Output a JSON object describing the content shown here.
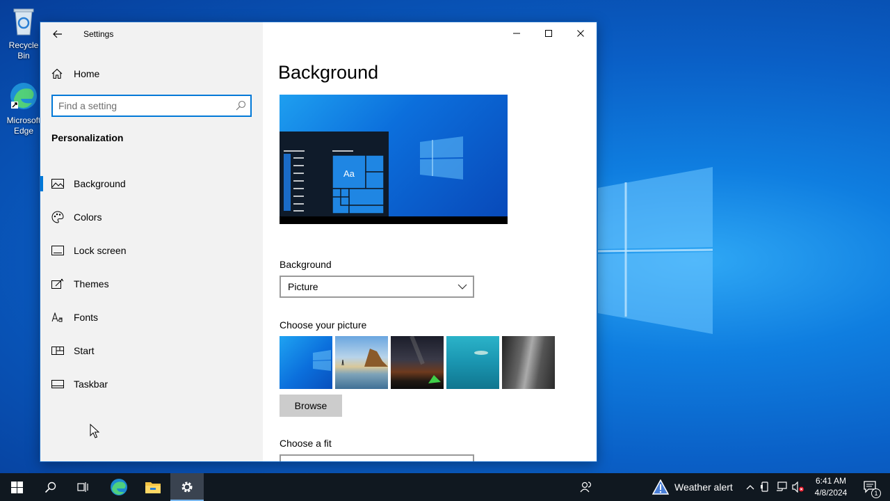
{
  "desktop": {
    "icons": [
      {
        "label": "Recycle Bin"
      },
      {
        "label": "Microsoft Edge"
      }
    ]
  },
  "window": {
    "title": "Settings",
    "controls": [
      "minimize-icon",
      "maximize-icon",
      "close-icon"
    ]
  },
  "sidebar": {
    "home_label": "Home",
    "search_placeholder": "Find a setting",
    "section_label": "Personalization",
    "items": [
      {
        "label": "Background",
        "icon": "picture-icon",
        "active": true
      },
      {
        "label": "Colors",
        "icon": "palette-icon",
        "active": false
      },
      {
        "label": "Lock screen",
        "icon": "lock-screen-icon",
        "active": false
      },
      {
        "label": "Themes",
        "icon": "themes-icon",
        "active": false
      },
      {
        "label": "Fonts",
        "icon": "fonts-icon",
        "active": false
      },
      {
        "label": "Start",
        "icon": "start-icon",
        "active": false
      },
      {
        "label": "Taskbar",
        "icon": "taskbar-icon",
        "active": false
      }
    ]
  },
  "content": {
    "title": "Background",
    "preview_tile_text": "Aa",
    "background_label": "Background",
    "background_value": "Picture",
    "choose_picture_label": "Choose your picture",
    "browse_label": "Browse",
    "choose_fit_label": "Choose a fit"
  },
  "taskbar": {
    "weather_label": "Weather alert",
    "time": "6:41 AM",
    "date": "4/8/2024",
    "notification_count": "1"
  },
  "colors": {
    "accent": "#0078d7",
    "sidebar_bg": "#f2f2f2",
    "taskbar_bg": "#101820"
  }
}
